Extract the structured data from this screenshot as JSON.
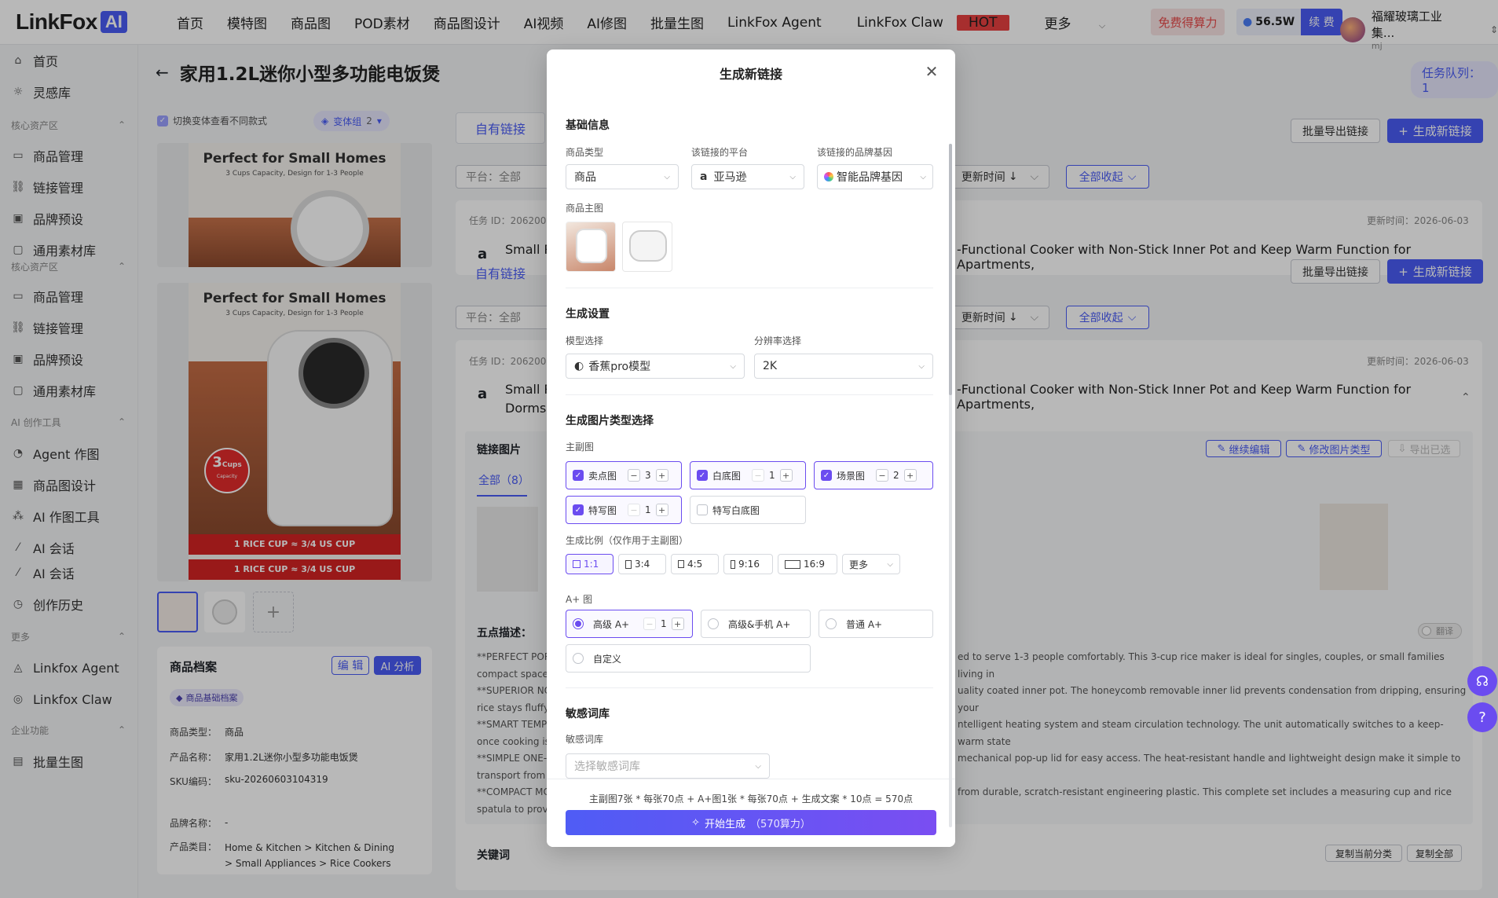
{
  "brand": {
    "logo_text": "LinkFox",
    "logo_badge": "AI"
  },
  "nav": {
    "items": [
      "首页",
      "模特图",
      "商品图",
      "POD素材",
      "商品图设计",
      "AI视频",
      "AI修图",
      "批量生图",
      "LinkFox Agent",
      "LinkFox Claw",
      "更多"
    ],
    "hot_badge": "HOT"
  },
  "header": {
    "free_points": "免费得算力",
    "points_value": "56.5W",
    "renew": "续 费",
    "user_name": "福耀玻璃工业集...",
    "user_sub": "mj"
  },
  "sidebar": {
    "top_items": [
      "首页",
      "灵感库"
    ],
    "sections": [
      {
        "title": "核心资产区",
        "items": [
          "商品管理",
          "链接管理",
          "品牌预设",
          "通用素材库"
        ]
      },
      {
        "title": "核心资产区",
        "items": [
          "商品管理",
          "链接管理",
          "品牌预设",
          "通用素材库"
        ]
      },
      {
        "title": "AI 创作工具",
        "items": [
          "Agent 作图",
          "商品图设计",
          "AI 作图工具",
          "AI 会话",
          "AI 会话",
          "创作历史"
        ]
      },
      {
        "title": "更多",
        "items": [
          "Linkfox Agent",
          "Linkfox Claw"
        ]
      },
      {
        "title": "企业功能",
        "items": [
          "批量生图"
        ]
      }
    ]
  },
  "page": {
    "title": "家用1.2L迷你小型多功能电饭煲",
    "task_queue": "任务队列：1",
    "variant_hint": "切换变体查看不同款式",
    "variant_group": "变体组",
    "variant_count": "2",
    "poster_title": "Perfect for Small Homes",
    "poster_sub": "3 Cups Capacity, Design for 1-3 People",
    "poster_cups": "3",
    "poster_cups_label": "Cups",
    "poster_cups_sub": "Capacity",
    "poster_banner": "1 RICE CUP ≈ 3/4 US CUP",
    "tab_own_links": "自有链接",
    "batch_export": "批量导出链接",
    "new_link": "生成新链接",
    "filter_platform": "平台：全部",
    "sort_update": "更新时间",
    "collapse_all": "全部收起",
    "task_id": "任务 ID：206200",
    "update_time": "更新时间：2026-06-03",
    "listing_title_a": "Small R",
    "listing_title_b": "-Functional Cooker with Non-Stick Inner Pot and Keep Warm Function for Apartments,",
    "listing_title_c": "Dorms,",
    "link_images": "链接图片",
    "continue_edit": "继续编辑",
    "modify_type": "修改图片类型",
    "export_selected": "导出已选",
    "tab_all": "全部（8）",
    "five_points": "五点描述：",
    "translate": "翻译",
    "bullets": [
      {
        "a": "**PERFECT POR",
        "b": "ed to serve 1-3 people comfortably. This 3-cup rice maker is ideal for singles, couples, or small families living in",
        "c": "compact spaces"
      },
      {
        "a": "**SUPERIOR NO",
        "b": "uality coated inner pot. The honeycomb removable inner lid prevents condensation from dripping, ensuring your",
        "c": "rice stays fluffy"
      },
      {
        "a": "**SMART TEMP",
        "b": "ntelligent heating system and steam circulation technology. The unit automatically switches to a keep-warm state",
        "c": "once cooking is"
      },
      {
        "a": "**SIMPLE ONE-",
        "b": "mechanical pop-up lid for easy access. The heat-resistant handle and lightweight design make it simple to",
        "c": "transport from t"
      },
      {
        "a": "**COMPACT MC",
        "b": "from durable, scratch-resistant engineering plastic. This complete set includes a measuring cup and rice",
        "c": "spatula to provi"
      }
    ],
    "keywords": "关键词",
    "copy_category": "复制当前分类",
    "copy_all": "复制全部",
    "product_profile": "商品档案",
    "edit": "编 辑",
    "ai_analyze": "AI 分析",
    "profile_badge": "商品基础档案",
    "profile_rows": [
      {
        "k": "商品类型：",
        "v": "商品"
      },
      {
        "k": "产品名称：",
        "v": "家用1.2L迷你小型多功能电饭煲"
      },
      {
        "k": "SKU编码：",
        "v": "sku-20260603104319"
      },
      {
        "k": "品牌名称：",
        "v": "-"
      },
      {
        "k": "产品类目：",
        "v": "Home & Kitchen > Kitchen & Dining > Small Appliances > Rice Cookers"
      }
    ]
  },
  "modal": {
    "title": "生成新链接",
    "basic_info": "基础信息",
    "product_type_label": "商品类型",
    "product_type_value": "商品",
    "platform_label": "该链接的平台",
    "platform_value": "亚马逊",
    "brand_gene_label": "该链接的品牌基因",
    "brand_gene_value": "智能品牌基因",
    "main_image_label": "商品主图",
    "gen_settings": "生成设置",
    "model_label": "模型选择",
    "model_value": "香蕉pro模型",
    "resolution_label": "分辨率选择",
    "resolution_value": "2K",
    "image_type_title": "生成图片类型选择",
    "main_sub_label": "主副图",
    "options": [
      {
        "label": "卖点图",
        "count": "3",
        "on": true
      },
      {
        "label": "白底图",
        "count": "1",
        "on": true
      },
      {
        "label": "场景图",
        "count": "2",
        "on": true
      },
      {
        "label": "特写图",
        "count": "1",
        "on": true
      },
      {
        "label": "特写白底图",
        "count": "",
        "on": false
      }
    ],
    "ratio_label": "生成比例（仅作用于主副图）",
    "ratios": [
      "1:1",
      "3:4",
      "4:5",
      "9:16",
      "16:9"
    ],
    "ratio_more": "更多",
    "aplus_label": "A+ 图",
    "aplus": [
      {
        "label": "高级 A+",
        "count": "1",
        "on": true
      },
      {
        "label": "高级&手机 A+",
        "on": false
      },
      {
        "label": "普通 A+",
        "on": false
      },
      {
        "label": "自定义",
        "on": false
      }
    ],
    "sensitive_title": "敏感词库",
    "sensitive_label": "敏感词库",
    "sensitive_placeholder": "选择敏感词库",
    "price_text": "主副图7张 * 每张70点 + A+图1张 * 每张70点 + 生成文案 * 10点 = 570点",
    "generate": "开始生成",
    "generate_cost": "（570算力）"
  },
  "colors": {
    "accent": "#4a5cf6",
    "purple": "#6b4cf0",
    "hot": "#e84040"
  }
}
